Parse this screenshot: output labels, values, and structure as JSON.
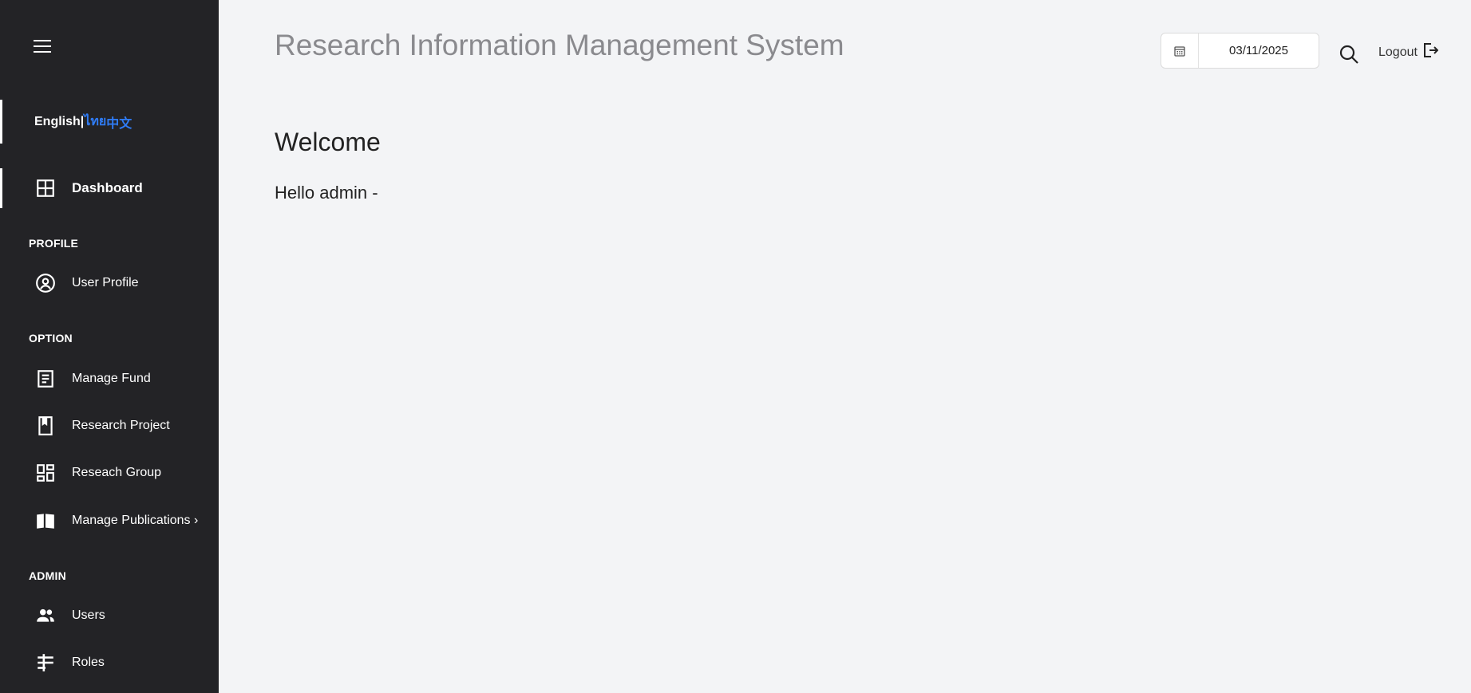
{
  "app": {
    "title": "Research Information Management System"
  },
  "language": {
    "english": "English",
    "separator": "|",
    "thai": "ไทย",
    "chinese": "中文"
  },
  "sidebar": {
    "dashboard": "Dashboard",
    "sections": {
      "profile": "PROFILE",
      "option": "OPTION",
      "admin": "ADMIN"
    },
    "items": {
      "user_profile": "User Profile",
      "manage_fund": "Manage Fund",
      "research_project": "Research Project",
      "research_group": "Reseach Group",
      "manage_publications": "Manage Publications ›",
      "users": "Users",
      "roles": "Roles"
    }
  },
  "header": {
    "date": "03/11/2025",
    "logout": "Logout"
  },
  "main": {
    "welcome": "Welcome",
    "hello": "Hello admin -"
  },
  "colors": {
    "sidebar_bg": "#232326",
    "accent": "#2f7cf6",
    "page_bg": "#f3f4f6"
  }
}
